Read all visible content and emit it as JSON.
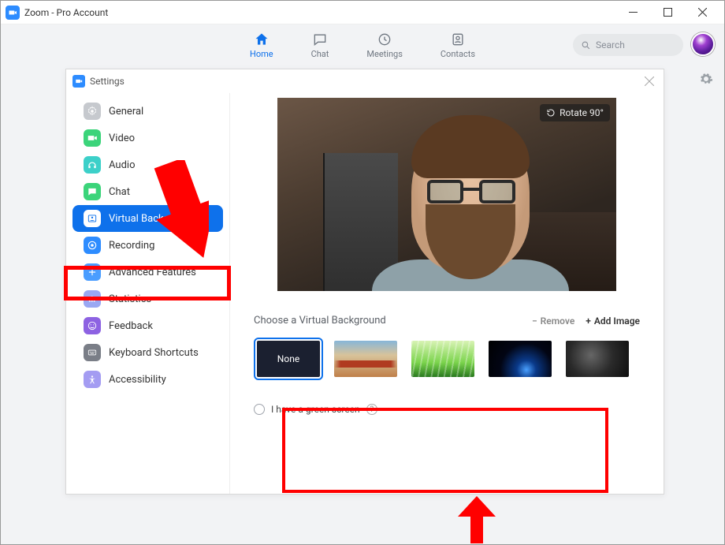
{
  "window": {
    "title": "Zoom - Pro Account"
  },
  "nav": {
    "items": [
      {
        "label": "Home",
        "active": true
      },
      {
        "label": "Chat",
        "active": false
      },
      {
        "label": "Meetings",
        "active": false
      },
      {
        "label": "Contacts",
        "active": false
      }
    ],
    "search_placeholder": "Search"
  },
  "settings": {
    "title": "Settings",
    "items": [
      {
        "label": "General"
      },
      {
        "label": "Video"
      },
      {
        "label": "Audio"
      },
      {
        "label": "Chat"
      },
      {
        "label": "Virtual Background",
        "active": true
      },
      {
        "label": "Recording"
      },
      {
        "label": "Advanced Features"
      },
      {
        "label": "Statistics"
      },
      {
        "label": "Feedback"
      },
      {
        "label": "Keyboard Shortcuts"
      },
      {
        "label": "Accessibility"
      }
    ]
  },
  "vb": {
    "rotate_label": "Rotate 90°",
    "choose_label": "Choose a Virtual Background",
    "remove_label": "Remove",
    "add_label": "Add Image",
    "greenscreen_label": "I have a green screen",
    "thumbs": [
      {
        "name": "None",
        "selected": true
      },
      {
        "name": "Golden Gate Bridge"
      },
      {
        "name": "Grass"
      },
      {
        "name": "Earth from Space"
      },
      {
        "name": "Dark Blur"
      }
    ]
  },
  "colors": {
    "accent": "#0e71eb",
    "annotation": "#ff0000"
  }
}
